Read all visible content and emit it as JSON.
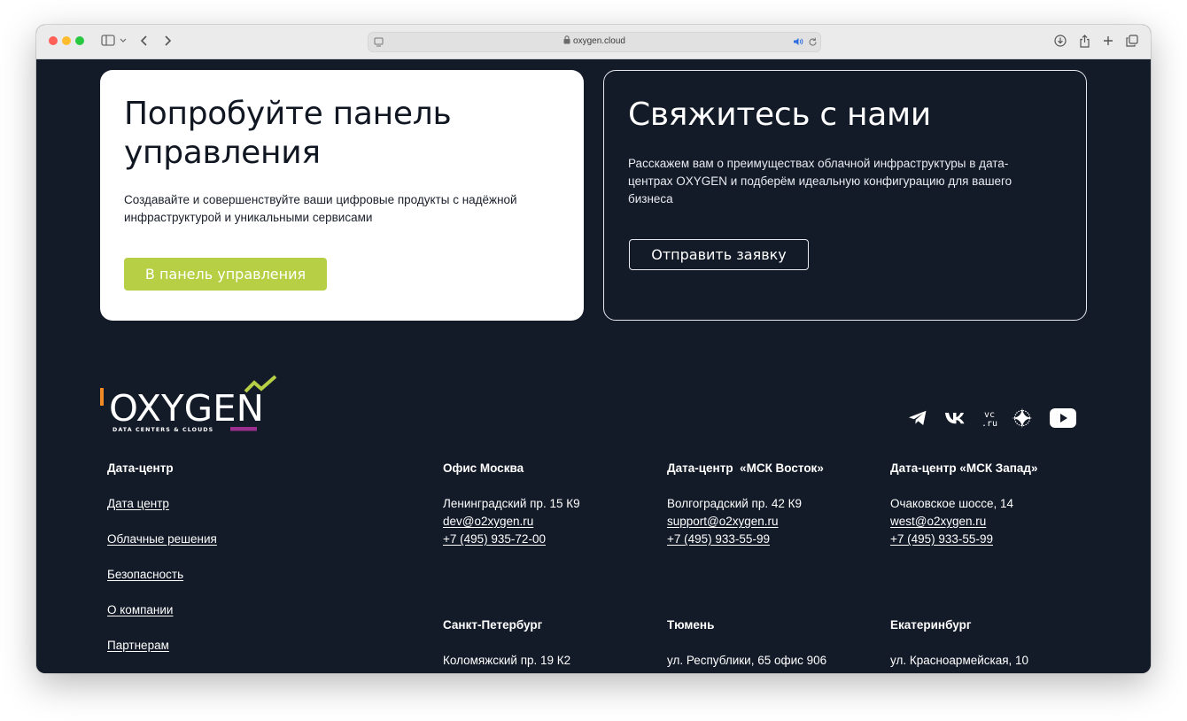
{
  "browser": {
    "url": "oxygen.cloud"
  },
  "cta_card": {
    "title": "Попробуйте панель управления",
    "text": "Создавайте и совершенствуйте ваши цифровые продукты с надёжной инфраструктурой и уникальными сервисами",
    "button_label": "В панель управления",
    "button_color": "#b6cf45"
  },
  "contact_card": {
    "title": "Свяжитесь с нами",
    "text": "Расскажем вам о преимуществах облачной инфраструктуры в дата-центрах OXYGEN и подберём идеальную конфигурацию для вашего бизнеса",
    "button_label": "Отправить заявку"
  },
  "logo": {
    "wordmark": "OXYGEN",
    "tagline": "DATA CENTERS & CLOUDS",
    "accent_green": "#b6cf45",
    "accent_orange": "#f08a24",
    "accent_purple": "#9b2f8f"
  },
  "socials": [
    "telegram-icon",
    "vk-icon",
    "vc-ru-icon",
    "dzen-icon",
    "youtube-icon"
  ],
  "footer": {
    "nav": {
      "heading": "Дата-центр",
      "links": [
        "Дата центр",
        "Облачные решения",
        "Безопасность",
        "О компании",
        "Партнерам"
      ]
    },
    "offices": [
      {
        "title": "Офис Москва",
        "address": "Ленинградский пр. 15 К9",
        "email": "dev@o2xygen.ru",
        "phone": "+7 (495) 935-72-00"
      },
      {
        "title": "Дата-центр  «МСК Восток»",
        "address": "Волгоградский пр. 42 К9",
        "email": "support@o2xygen.ru",
        "phone": "+7 (495) 933-55-99"
      },
      {
        "title": "Дата-центр «МСК Запад»",
        "address": "Очаковское шоссе, 14",
        "email": "west@o2xygen.ru",
        "phone": "+7 (495) 933-55-99"
      },
      {
        "title": "Санкт-Петербург",
        "address": "Коломяжский пр. 19 К2"
      },
      {
        "title": "Тюмень",
        "address": "ул. Республики, 65 офис 906"
      },
      {
        "title": "Екатеринбург",
        "address": "ул. Красноармейская, 10"
      }
    ]
  }
}
